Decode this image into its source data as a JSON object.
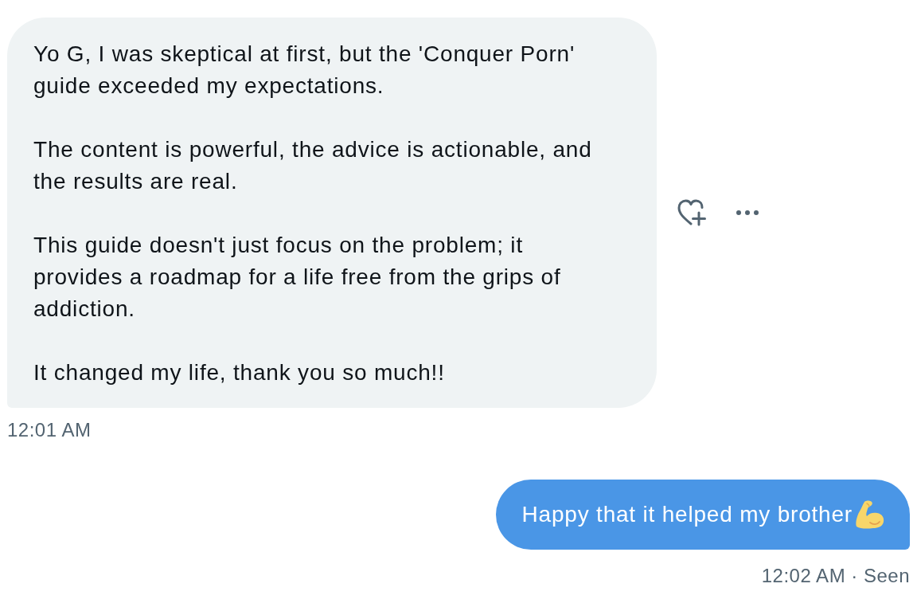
{
  "messages": [
    {
      "kind": "received",
      "paragraphs": [
        "Yo G, I was skeptical at first, but the 'Conquer Porn' guide exceeded my expectations.",
        "The content is powerful, the advice is actionable, and the results are real.",
        "This guide doesn't just focus on the problem; it provides a roadmap for a life free from the grips of addiction.",
        "It changed my life, thank you so much!!"
      ],
      "footer": "12:01 AM"
    },
    {
      "kind": "sent",
      "paragraphs": [
        "Happy that it helped my brother"
      ],
      "footer": "12:02 AM · Seen"
    }
  ]
}
